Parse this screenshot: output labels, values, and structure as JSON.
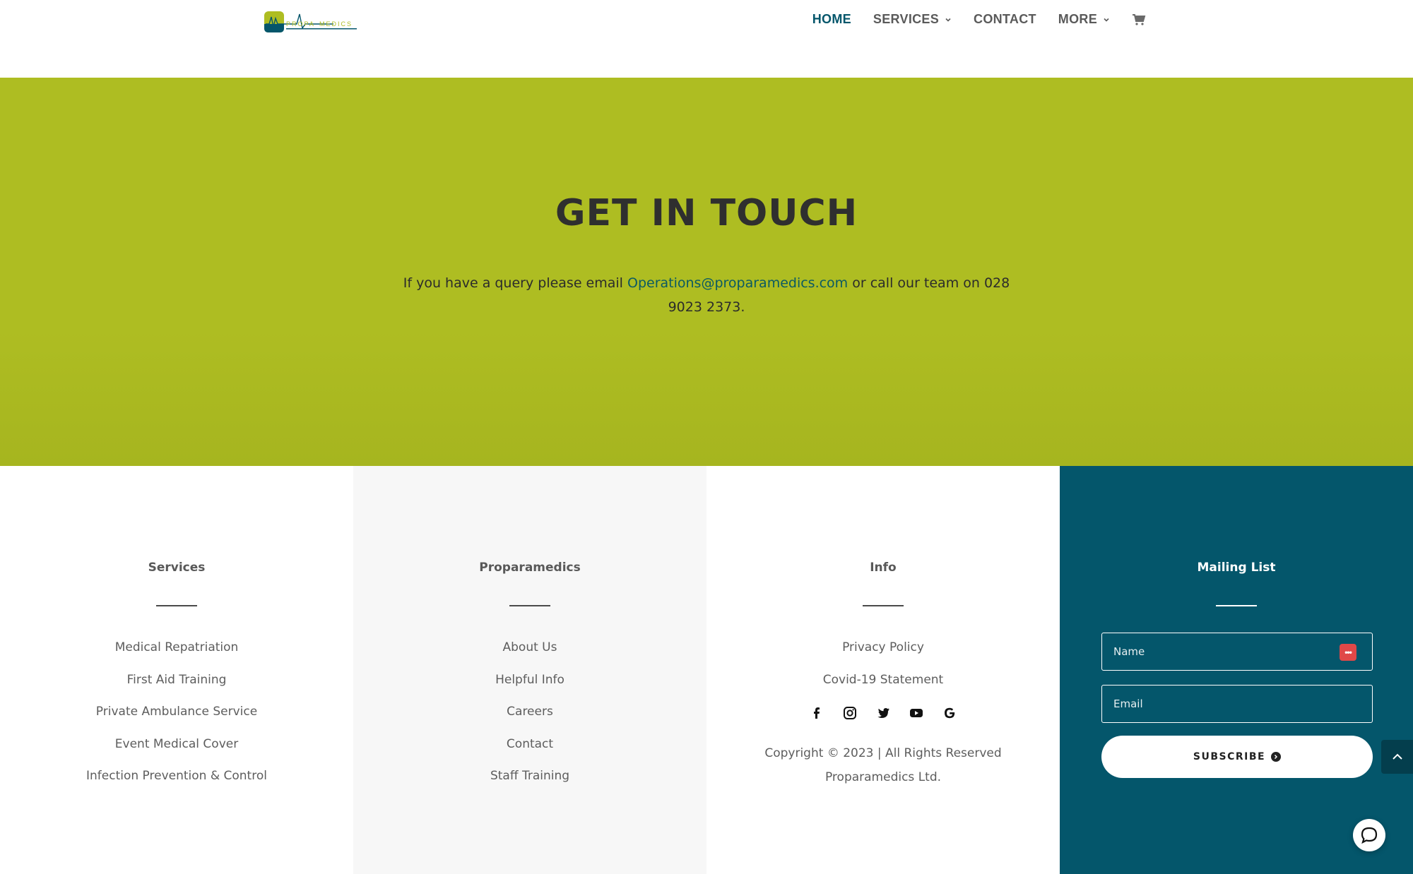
{
  "header": {
    "logo_text": "PROPARAMEDICS",
    "nav": [
      {
        "label": "HOME",
        "active": true,
        "dropdown": false
      },
      {
        "label": "SERVICES",
        "active": false,
        "dropdown": true
      },
      {
        "label": "CONTACT",
        "active": false,
        "dropdown": false
      },
      {
        "label": "MORE",
        "active": false,
        "dropdown": true
      }
    ],
    "cart_icon": "cart-icon"
  },
  "hero": {
    "title": "GET IN TOUCH",
    "text_before": "If you have a query please email ",
    "email": "Operations@proparamedics.com",
    "text_after": " or call our team on 028 9023 2373."
  },
  "footer": {
    "services": {
      "title": "Services",
      "links": [
        "Medical Repatriation",
        "First Aid Training",
        "Private Ambulance Service",
        "Event Medical Cover",
        "Infection Prevention & Control"
      ]
    },
    "proparamedics": {
      "title": "Proparamedics",
      "links": [
        "About Us",
        "Helpful Info",
        "Careers",
        "Contact",
        "Staff Training"
      ]
    },
    "info": {
      "title": "Info",
      "links": [
        "Privacy Policy",
        "Covid-19 Statement"
      ],
      "socials": [
        "facebook-icon",
        "instagram-icon",
        "twitter-icon",
        "youtube-icon",
        "google-icon"
      ],
      "copyright": "Copyright © 2023 | All Rights Reserved Proparamedics Ltd."
    },
    "mailing": {
      "title": "Mailing List",
      "name_placeholder": "Name",
      "email_placeholder": "Email",
      "subscribe_label": "SUBSCRIBE"
    }
  },
  "colors": {
    "accent_green": "#aebd22",
    "brand_teal": "#04566b",
    "nav_active": "#04566b"
  }
}
